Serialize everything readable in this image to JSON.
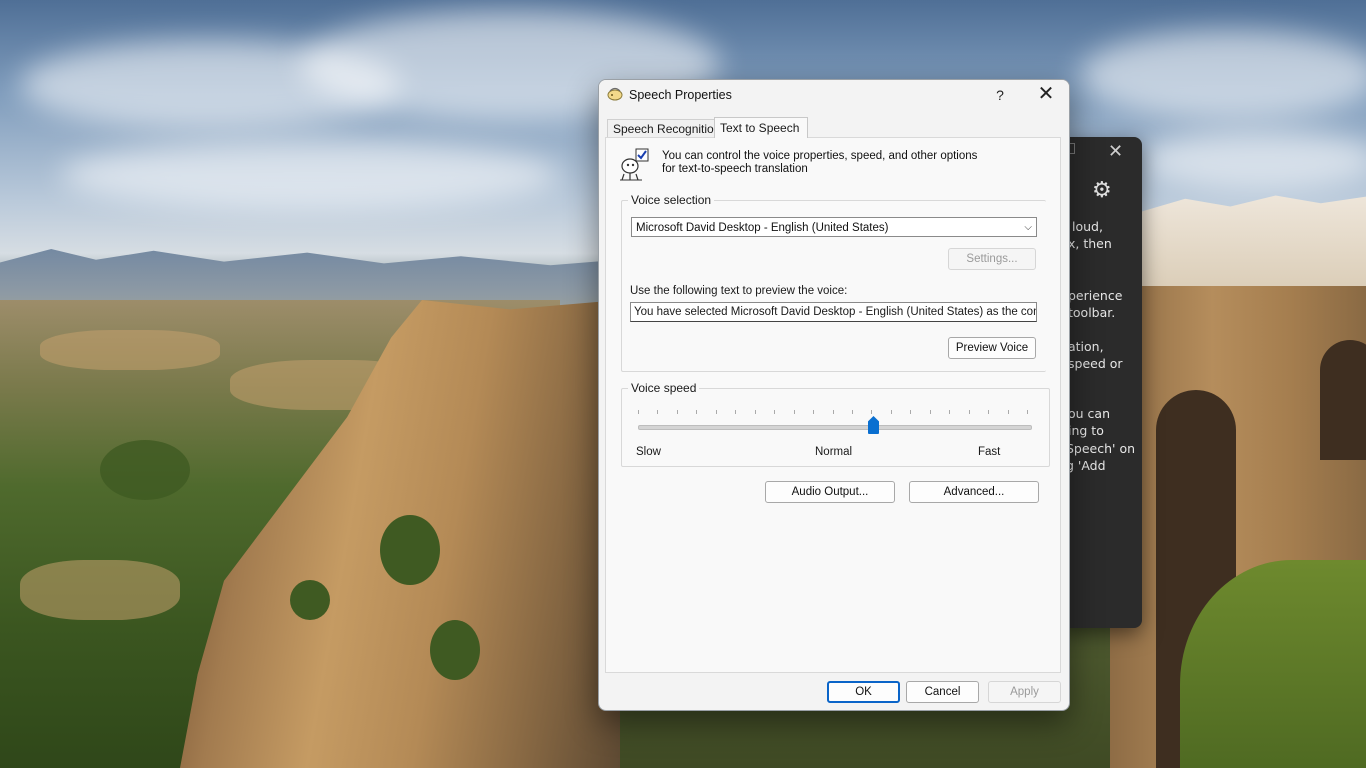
{
  "dialog": {
    "title": "Speech Properties",
    "help_label": "?",
    "close_label": "✕"
  },
  "tabs": [
    {
      "label": "Speech Recognition",
      "active": false
    },
    {
      "label": "Text to Speech",
      "active": true
    }
  ],
  "intro_text": "You can control the voice properties, speed, and other options for text-to-speech translation",
  "voice_selection": {
    "legend": "Voice selection",
    "selected_voice": "Microsoft David Desktop - English (United States)",
    "settings_label": "Settings...",
    "preview_label": "Use the following text to preview the voice:",
    "preview_text": "You have selected Microsoft David Desktop - English (United States) as the computer",
    "preview_button": "Preview Voice"
  },
  "voice_speed": {
    "legend": "Voice speed",
    "slow_label": "Slow",
    "normal_label": "Normal",
    "fast_label": "Fast",
    "value_fraction": 0.6
  },
  "buttons": {
    "audio_output": "Audio Output...",
    "advanced": "Advanced...",
    "ok": "OK",
    "cancel": "Cancel",
    "apply": "Apply"
  },
  "background_window": {
    "close_label": "✕",
    "gear_icon": "gear-icon",
    "lines": [
      "loud,",
      "x, then",
      "perience",
      "toolbar.",
      "ation,",
      "speed or",
      "ou can",
      "ing to",
      "Speech' on",
      "g 'Add"
    ]
  },
  "colors": {
    "accent": "#0a6fd0",
    "dark_window": "#2b2b2b"
  }
}
